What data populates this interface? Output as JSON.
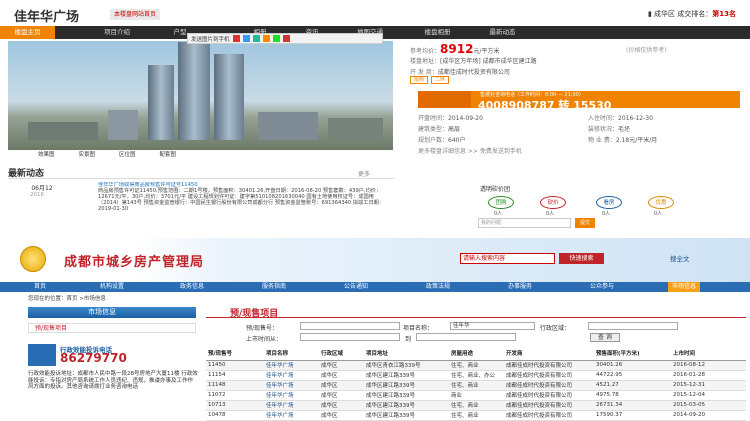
{
  "header": {
    "brand": "佳年华广场",
    "brand_tag": "本楼盘网站首页",
    "rank_prefix": "成华区 成交排名：",
    "rank_value": "第13名"
  },
  "nav": {
    "tabs": [
      "楼盘主页",
      "项目介绍",
      "户型",
      "相册",
      "资讯",
      "地图交通",
      "楼盘相册",
      "最新动态"
    ]
  },
  "share": {
    "label": "发送图片到手机"
  },
  "photo": {
    "thumbs": [
      "效果图",
      "实景图",
      "区位图",
      "配套图"
    ]
  },
  "info": {
    "price_label": "参考均价：",
    "price_value": "8912",
    "price_unit": "元/平方米",
    "price_note": "(价格仅供参考)",
    "address_label": "楼盘地址：",
    "address_value": "[成华区万年场] 成都市成华区建江路",
    "developer_label": "开 发 商：",
    "developer_value": "成都佳成时代投资有限公司",
    "tags": [
      "限购",
      "二环"
    ],
    "phone_hint": "售楼处咨询电话（工作时间：8:00 — 21:00）",
    "phone_number": "4008908787 转 15530",
    "open_label": "开盘时间：",
    "open_value": "2014-09-20",
    "handover_label": "入住时间：",
    "handover_value": "2016-12-30",
    "type_label": "建筑类型：",
    "type_value": "高层",
    "fitout_label": "装修状况：",
    "fitout_value": "毛坯",
    "households_label": "规划户数：",
    "households_value": "640户",
    "fee_label": "物 业 费：",
    "fee_value": "2.18元/平米/月",
    "more": "更多楼盘详细信息 >>   免费发送到手机"
  },
  "news": {
    "title": "最新动态",
    "more": "更多",
    "date": "06月12",
    "year": "2016",
    "headline": "佳年华广场取得商品房预售许可证号11450",
    "body": "商品房预售许可证11450,预售范围：二期1号楼，预售面积：30401.26,开盘日期：2016-08-20 预售套数：439户,均价：12671元/平，30户,均价：3701元/平 建设工程规划许可证：建字第510108201630040 国有土地使用权证号：成国用（2014）第143号 预售资金监管银行：中国民生银行股份有限公司成都分行 预售资金监管账号：691364340 拟竣工日期：2019-01-30"
  },
  "vote": {
    "title": "透明砍价团",
    "options": [
      "团购",
      "砍价",
      "看房",
      "优惠"
    ],
    "counts": [
      "0人",
      "0人",
      "0人",
      "0人"
    ],
    "input_placeholder": "我的问题",
    "submit": "提交"
  },
  "bureau": {
    "title": "成都市城乡房产管理局",
    "search_placeholder": "请输入搜索内容",
    "search_button": "快速搜索",
    "search_all": "搜全文",
    "nav": [
      "首页",
      "机构设置",
      "政务信息",
      "服务指南",
      "公告通知",
      "政策法规",
      "办事服务",
      "公众参与",
      "市场信息"
    ],
    "breadcrumb": "您现在的位置：首页 >市场信息"
  },
  "sidebar": {
    "title": "市场信息",
    "item": "预/现售项目",
    "hotline_label": "行政效能投诉电话",
    "hotline_number": "86279770",
    "address_text": "行政效能投诉地址：成都市人民中路一段28号房地产大厦11楼 行政效能投诉：专指对房产局系统工作人员违纪、违规，推诿办事及工作作风方面的投诉。其他咨询请拨打业务咨询电话"
  },
  "presale": {
    "title": "预/现售项目",
    "f_presale_label": "预/现售号：",
    "f_project_label": "项目名称：",
    "f_project_value": "佳年华",
    "f_district_label": "行政区域：",
    "f_date_label": "上市时间从：",
    "f_to_label": "到",
    "query_button": "查 询",
    "columns": [
      "预/现售号",
      "项目名称",
      "行政区域",
      "项目地址",
      "房屋用途",
      "开发商",
      "预售面积(平方米)",
      "上市时间"
    ],
    "rows": [
      [
        "11450",
        "佳年华广场",
        "成华区",
        "成华区青衣江路339号",
        "住宅、商业",
        "成都佳成时代投资有限公司",
        "30401.26",
        "2016-08-12"
      ],
      [
        "11154",
        "佳年华广场",
        "成华区",
        "成华区建江路339号",
        "住宅、商业、办公",
        "成都佳成时代投资有限公司",
        "44722.95",
        "2016-01-28"
      ],
      [
        "11148",
        "佳年华广场",
        "成华区",
        "成华区建江路339号",
        "住宅、商业",
        "成都佳成时代投资有限公司",
        "4521.27",
        "2015-12-31"
      ],
      [
        "11072",
        "佳年华广场",
        "成华区",
        "成华区建江路339号",
        "商业",
        "成都佳成时代投资有限公司",
        "4975.78",
        "2015-12-04"
      ],
      [
        "10713",
        "佳年华广场",
        "成华区",
        "成华区建江路339号",
        "住宅、商业",
        "成都佳成时代投资有限公司",
        "26731.34",
        "2015-03-05"
      ],
      [
        "10478",
        "佳年华广场",
        "成华区",
        "成华区建江路339号",
        "住宅、商业",
        "成都佳成时代投资有限公司",
        "17590.37",
        "2014-09-20"
      ]
    ]
  },
  "colors": {
    "accent": "#f08300",
    "price_red": "#e50000",
    "bureau_red": "#c0232a",
    "bureau_blue": "#2a6db5"
  }
}
